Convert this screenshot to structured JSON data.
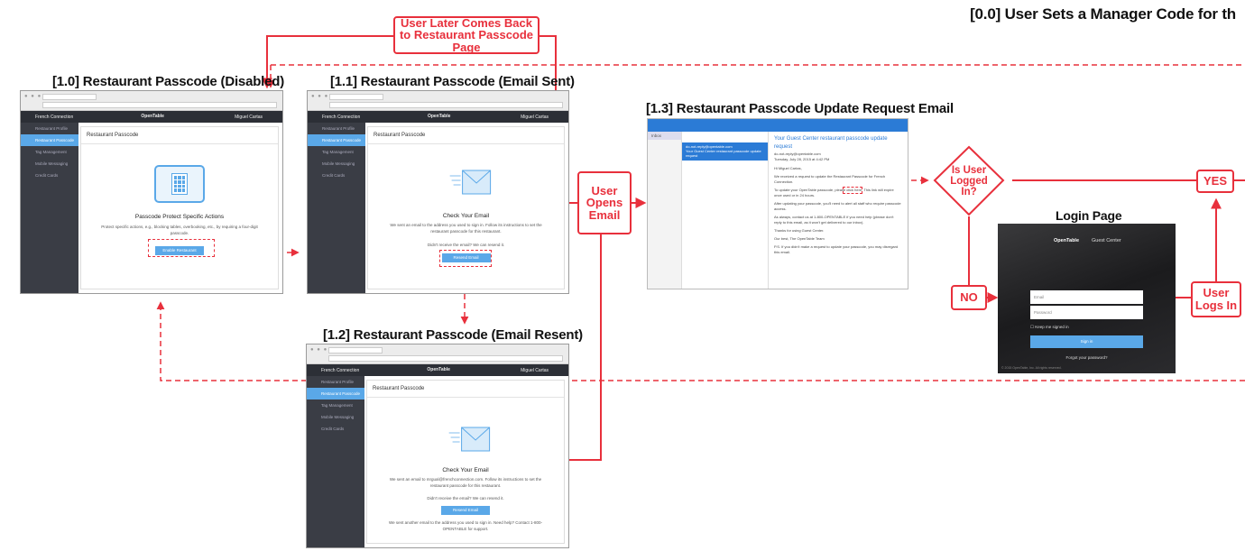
{
  "main_title": "[0.0] User Sets a Manager Code for th",
  "titles": {
    "s10": "[1.0] Restaurant Passcode (Disabled)",
    "s11": "[1.1] Restaurant Passcode (Email Sent)",
    "s12": "[1.2] Restaurant Passcode (Email Resent)",
    "s13": "[1.3] Restaurant Passcode Update Request Email",
    "login": "Login Page"
  },
  "flow_labels": {
    "comes_back": "User Later Comes Back to Restaurant Passcode Page",
    "opens_email": "User Opens Email",
    "is_logged_in": "Is User Logged In?",
    "yes": "YES",
    "no": "NO",
    "logs_in": "User Logs In"
  },
  "app": {
    "restaurant": "French Connection",
    "brand": "OpenTable",
    "user": "Miguel Cartas",
    "sidebar": [
      "Restaurant Profile",
      "Restaurant Passcode",
      "Tag Management",
      "Mobile Messaging",
      "Credit Cards"
    ],
    "page_header": "Restaurant Passcode"
  },
  "s10": {
    "heading": "Passcode Protect Specific Actions",
    "text": "Protect specific actions, e.g., blocking tables, overbooking, etc., by requiring a four-digit passcode.",
    "button": "Enable Restaurant Passcode"
  },
  "s11": {
    "heading": "Check Your Email",
    "text": "We sent an email to the address you used to sign in. Follow its instructions to set the restaurant passcode for this restaurant.",
    "resend_q": "Didn't receive the email? We can resend it.",
    "button": "Resend Email"
  },
  "s12": {
    "heading": "Check Your Email",
    "text": "We sent an email to mrgual@frenchconnection.com. Follow its instructions to set the restaurant passcode for this restaurant.",
    "resend_q": "Didn't receive the email? We can resend it.",
    "button": "Resend Email",
    "note": "We sent another email to the address you used to sign in. Need help? Contact 1-800-OPENTABLE for support."
  },
  "email": {
    "folder": "Inbox",
    "from": "do-not-reply@opentable.com",
    "subject_short": "Your Guest Center restaurant passcode update request",
    "subject": "Your Guest Center restaurant passcode update request",
    "date": "Tuesday, July 28, 2015 at 4:42 PM",
    "greeting": "Hi Miguel Cartas,",
    "p1": "We received a request to update the Restaurant Passcode for French Connection.",
    "p2": "To update your OpenTable passcode, please click here. This link will expire once used or in 24 hours.",
    "p3": "After updating your passcode, you'll need to alert all staff who require passcode access.",
    "p4": "As always, contact us at 1-800-OPENTABLE if you need help (please don't reply to this email, as it won't get delivered to our inbox).",
    "p5": "Thanks for using Guest Center.",
    "sign": "Our best, The OpenTable Team",
    "ps": "P.S. If you didn't make a request to update your passcode, you may disregard this email."
  },
  "loginpage": {
    "brand": "OpenTable",
    "product": "Guest Center",
    "email_ph": "Email",
    "password_ph": "Password",
    "keep": "Keep me signed in",
    "signin": "Sign in",
    "forgot": "Forgot your password?",
    "copyright": "© 2015 OpenTable, Inc. All rights reserved."
  },
  "colors": {
    "accent": "#e8303c",
    "primary": "#5aa8e8"
  }
}
